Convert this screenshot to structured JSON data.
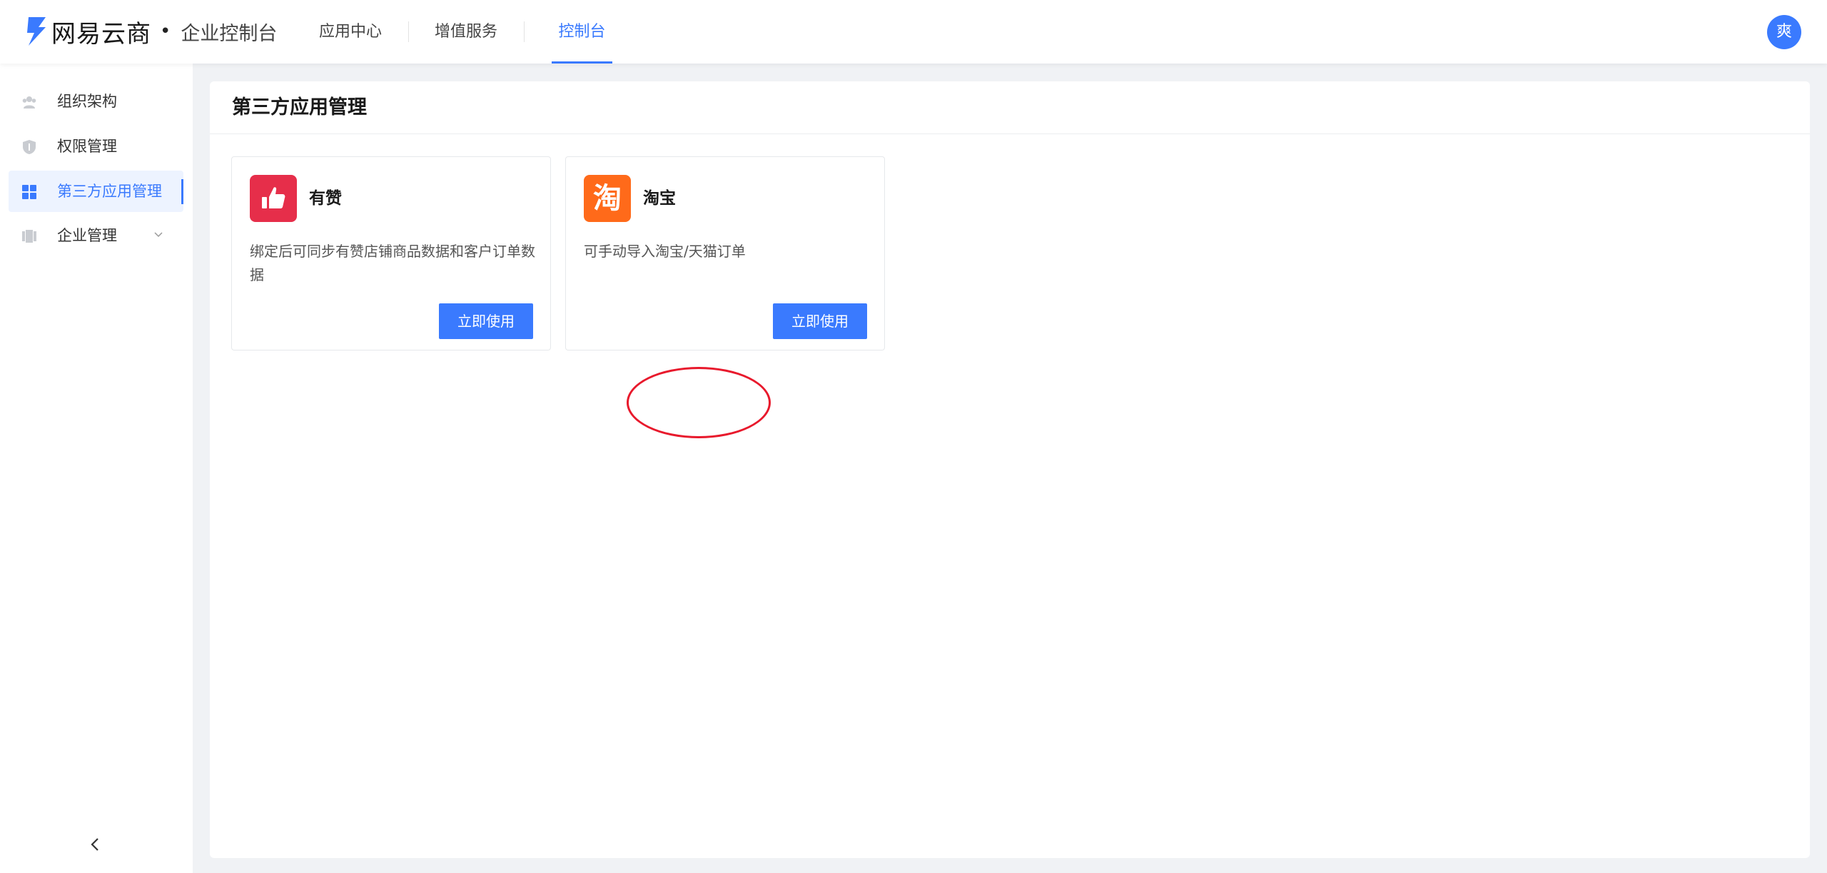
{
  "header": {
    "brand_name": "网易云商",
    "brand_dot": "•",
    "brand_sub": "企业控制台",
    "tabs": [
      {
        "label": "应用中心"
      },
      {
        "label": "增值服务"
      },
      {
        "label": "控制台"
      }
    ],
    "avatar_text": "爽"
  },
  "sidebar": {
    "items": [
      {
        "label": "组织架构",
        "icon": "team-icon"
      },
      {
        "label": "权限管理",
        "icon": "shield-icon"
      },
      {
        "label": "第三方应用管理",
        "icon": "grid-apps-icon"
      },
      {
        "label": "企业管理",
        "icon": "building-icon"
      }
    ]
  },
  "main": {
    "title": "第三方应用管理",
    "cards": [
      {
        "name": "有赞",
        "icon": "thumbs-up-icon",
        "desc": "绑定后可同步有赞店铺商品数据和客户订单数据",
        "button": "立即使用"
      },
      {
        "name": "淘宝",
        "icon": "taobao-icon",
        "icon_text": "淘",
        "desc": "可手动导入淘宝/天猫订单",
        "button": "立即使用"
      }
    ]
  },
  "colors": {
    "accent": "#3a7afe",
    "youzan_red": "#e62e4a",
    "taobao_orange": "#ff6a1a",
    "annotation_red": "#e8192c"
  }
}
